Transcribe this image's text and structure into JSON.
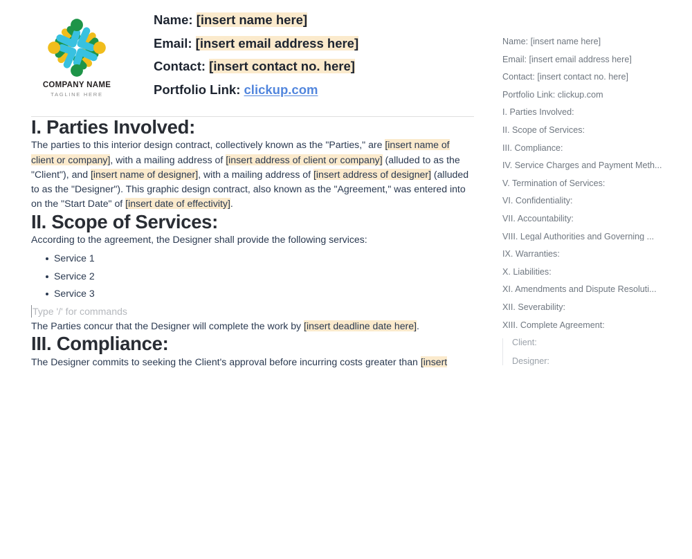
{
  "logo": {
    "name": "COMPANY NAME",
    "tagline": "TAGLINE HERE",
    "colors": {
      "cyan": "#38c1e0",
      "green": "#1e9448",
      "yellow": "#f0bd1c",
      "text": "#231f20"
    }
  },
  "header": {
    "name_label": "Name:",
    "name_value": "[insert name here]",
    "email_label": "Email:",
    "email_value": "[insert email address here]",
    "contact_label": "Contact:",
    "contact_value": "[insert contact no. here]",
    "portfolio_label": "Portfolio Link:",
    "portfolio_value": "clickup.com"
  },
  "sections": {
    "s1": {
      "heading": "I. Parties Involved:",
      "p1_a": "The parties to this interior design contract, collectively known as the \"Parties,\" are ",
      "p1_h1": "[insert name of client or company]",
      "p1_b": ", with a mailing address of ",
      "p1_h2": "[insert address of client or company]",
      "p1_c": " (alluded to as the \"Client\"), and ",
      "p1_h3": "[insert name of designer]",
      "p1_d": ", with a mailing address of ",
      "p1_h4": "[insert address of designer]",
      "p1_e": " (alluded to as the \"Designer\"). This graphic design contract, also known as the \"Agreement,\" was entered into on the \"Start Date\" of ",
      "p1_h5": "[insert date of effectivity]",
      "p1_f": "."
    },
    "s2": {
      "heading": "II. Scope of Services:",
      "intro": "According to the agreement, the Designer shall provide the following services:",
      "services": [
        "Service 1",
        "Service 2",
        "Service 3"
      ],
      "command_placeholder": "Type '/' for commands",
      "deadline_a": "The Parties concur that the Designer will complete the work by ",
      "deadline_h": "[insert deadline date here]",
      "deadline_b": "."
    },
    "s3": {
      "heading": "III. Compliance:",
      "p_a": "The Designer commits to seeking the Client's approval before incurring costs greater than ",
      "p_h": "[insert"
    }
  },
  "outline": {
    "items": [
      "Name: [insert name here]",
      "Email: [insert email address here]",
      "Contact: [insert contact no. here]",
      "Portfolio Link: clickup.com",
      "I. Parties Involved:",
      "II. Scope of Services:",
      "III. Compliance:",
      "IV. Service Charges and Payment Meth...",
      "V. Termination of Services:",
      "VI. Confidentiality:",
      "VII. Accountability:",
      "VIII. Legal Authorities and Governing ...",
      "IX. Warranties:",
      "X. Liabilities:",
      "XI. Amendments and Dispute Resoluti...",
      "XII. Severability:",
      "XIII. Complete Agreement:"
    ],
    "sub_items": [
      "Client:",
      "Designer:"
    ]
  },
  "theme": {
    "highlight": "#fbeacc",
    "link": "#5286dd",
    "heading": "#292d34",
    "body_text": "#2a3950",
    "outline_text": "#6f7780"
  }
}
